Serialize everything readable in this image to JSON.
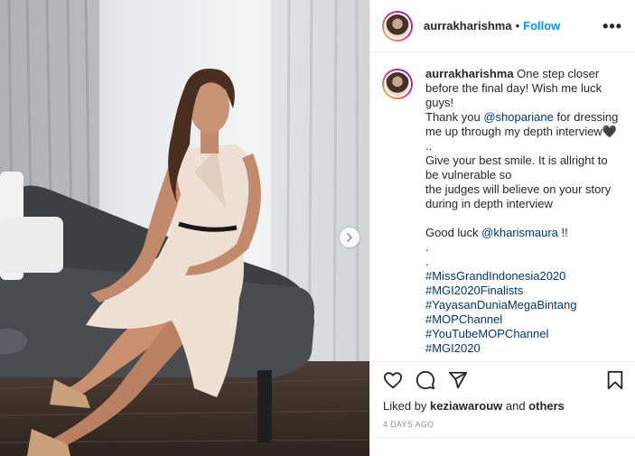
{
  "post": {
    "username": "aurrakharishma",
    "separator": "•",
    "follow_label": "Follow",
    "more_label": "•••"
  },
  "caption": {
    "username": "aurrakharishma",
    "line1": " One step closer before the final day! Wish me luck guys!\nThank you ",
    "mention1": "@shopariane",
    "line2": " for dressing me up through my depth interview🖤\n..\nGive your best smile. It is allright to be vulnerable so\nthe judges will believe on your story during in depth interview\n\nGood luck ",
    "mention2": "@kharismaura",
    "line3": " !!\n.\n.\n",
    "hashtags": [
      "#MissGrandIndonesia2020",
      "#MGI2020Finalists",
      "#YayasanDuniaMegaBintang",
      "#MOPChannel",
      "#YouTubeMOPChannel",
      "#MGI2020"
    ]
  },
  "likes": {
    "prefix": "Liked by ",
    "user": "keziawarouw",
    "middle": " and ",
    "others": "others"
  },
  "timestamp": "4 DAYS AGO",
  "icons": [
    "heart-icon",
    "comment-icon",
    "share-icon",
    "bookmark-icon",
    "chevron-right-icon"
  ],
  "colors": {
    "accent": "#0095f6",
    "link": "#00376b",
    "text": "#262626",
    "muted": "#8e8e8e",
    "border": "#efefef"
  }
}
